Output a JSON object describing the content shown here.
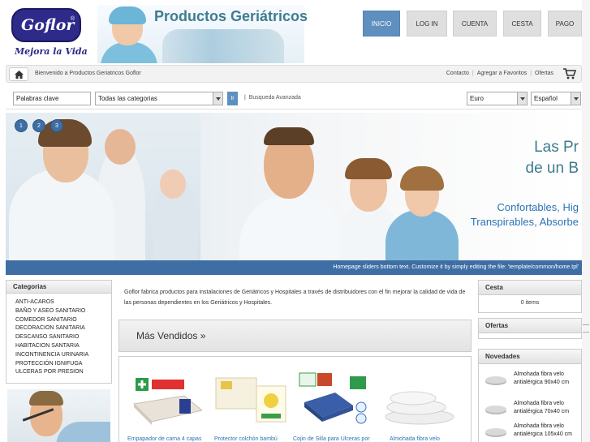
{
  "header": {
    "logo_text": "Goflor",
    "logo_mark": "®",
    "slogan": "Mejora la Vida",
    "site_title": "Productos Geriátricos"
  },
  "nav": [
    {
      "label": "INICIO",
      "active": true
    },
    {
      "label": "LOG IN",
      "active": false
    },
    {
      "label": "CUENTA",
      "active": false
    },
    {
      "label": "CESTA",
      "active": false
    },
    {
      "label": "PAGO",
      "active": false
    }
  ],
  "topbar": {
    "welcome": "Bienvenido a Productos Geriatricos Goflor",
    "links": [
      "Contacto",
      "Agregar a Favoritos",
      "Ofertas"
    ],
    "icons": {
      "home": "home-icon",
      "cart": "cart-icon"
    }
  },
  "search": {
    "keywords_value": "Palabras clave",
    "category_value": "Todas las categorias",
    "go_label": "Ir",
    "separator": "|",
    "advanced_label": "Busqueda Avanzada",
    "currency_value": "Euro",
    "language_value": "Español"
  },
  "slider": {
    "dots": [
      "1",
      "2",
      "3"
    ],
    "headline_1": "Las Pr",
    "headline_2": "de un B",
    "line_1": "Confortables, Hig",
    "line_2": "Transpirables, Absorbe",
    "caption": "Homepage sliders bottom text. Customize it by simply editing the file: 'template/common/home.tpl'"
  },
  "categories": {
    "title": "Categorias",
    "items": [
      "ANTI-ACAROS",
      "BAÑO Y ASEO SANITARIO",
      "COMEDOR SANITARIO",
      "DECORACION SANITARIA",
      "DESCANSO SANITARIO",
      "HABITACION SANTARIA",
      "INCONTINENCIA URINARIA",
      "PROTECCIÓN IGNIFUGA",
      "ULCERAS POR PRESION"
    ]
  },
  "intro": {
    "text": "Goflor fabrica productos para instalaciones de Geriátricos y Hospitales  a través de distribuidores con el fin mejorar la calidad de vida de las personas dependientes en los Geriátricos y Hospitales."
  },
  "bestsellers": {
    "title": "Más Vendidos »",
    "products": [
      "Empapador de cama 4 capas",
      "Protector colchón  bambú",
      "Cojin de Silla para Ulceras por",
      "Almohada fibra velo"
    ]
  },
  "cesta": {
    "title": "Cesta",
    "items_text": "0 items"
  },
  "ofertas": {
    "title": "Ofertas"
  },
  "novedades": {
    "title": "Novedades",
    "items": [
      {
        "line1": "Almohada fibra velo",
        "line2": "antialérgica 90x40 cm"
      },
      {
        "line1": "Almohada fibra velo",
        "line2": "antialérgica 70x40 cm"
      },
      {
        "line1": "Almohada fibra velo",
        "line2": "antialérgica 105x40 cm"
      }
    ]
  },
  "colors": {
    "brand": "#2d2a8a",
    "accent": "#5f8fbf",
    "title_green": "#3f7c8f",
    "link_blue": "#2c73b6"
  }
}
